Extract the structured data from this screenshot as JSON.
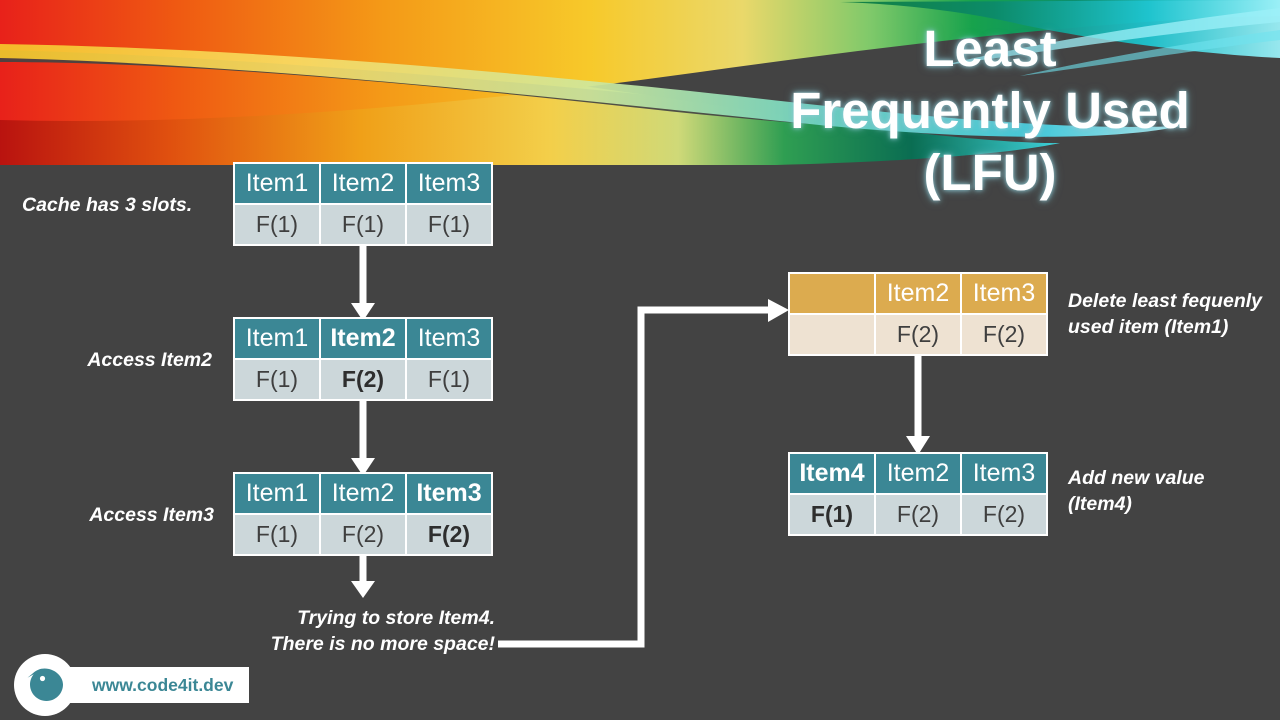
{
  "title": {
    "line1": "Least",
    "line2": "Frequently Used",
    "line3": "(LFU)"
  },
  "colors": {
    "background": "#434343",
    "teal_header": "#3b8795",
    "teal_body": "#ccd7da",
    "orange_header": "#dcab4f",
    "orange_body": "#eee2d2",
    "text_white": "#ffffff",
    "logo_teal": "#3b8795"
  },
  "labels": {
    "cache_slots": "Cache has 3 slots.",
    "access_item2": "Access Item2",
    "access_item3": "Access Item3",
    "no_space": "Trying to store Item4. There is no more space!",
    "delete_lfu": "Delete least fequenly used item (Item1)",
    "add_new": "Add new value (Item4)"
  },
  "tables": {
    "initial": {
      "name": "initial-cache-state",
      "header": [
        "Item1",
        "Item2",
        "Item3"
      ],
      "body": [
        "F(1)",
        "F(1)",
        "F(1)"
      ],
      "highlight": [
        false,
        false,
        false
      ],
      "style": "teal"
    },
    "after_item2": {
      "name": "cache-after-access-item2",
      "header": [
        "Item1",
        "Item2",
        "Item3"
      ],
      "body": [
        "F(1)",
        "F(2)",
        "F(1)"
      ],
      "highlight": [
        false,
        true,
        false
      ],
      "style": "teal"
    },
    "after_item3": {
      "name": "cache-after-access-item3",
      "header": [
        "Item1",
        "Item2",
        "Item3"
      ],
      "body": [
        "F(1)",
        "F(2)",
        "F(2)"
      ],
      "highlight": [
        false,
        false,
        true
      ],
      "style": "teal"
    },
    "evicted": {
      "name": "cache-after-eviction",
      "header": [
        "",
        "Item2",
        "Item3"
      ],
      "body": [
        "",
        "F(2)",
        "F(2)"
      ],
      "highlight": [
        false,
        false,
        false
      ],
      "style": "orange"
    },
    "final": {
      "name": "cache-after-insert-item4",
      "header": [
        "Item4",
        "Item2",
        "Item3"
      ],
      "body": [
        "F(1)",
        "F(2)",
        "F(2)"
      ],
      "highlight": [
        true,
        false,
        false
      ],
      "style": "teal"
    }
  },
  "footer": {
    "url": "www.code4it.dev",
    "logo": "bird-logo"
  }
}
